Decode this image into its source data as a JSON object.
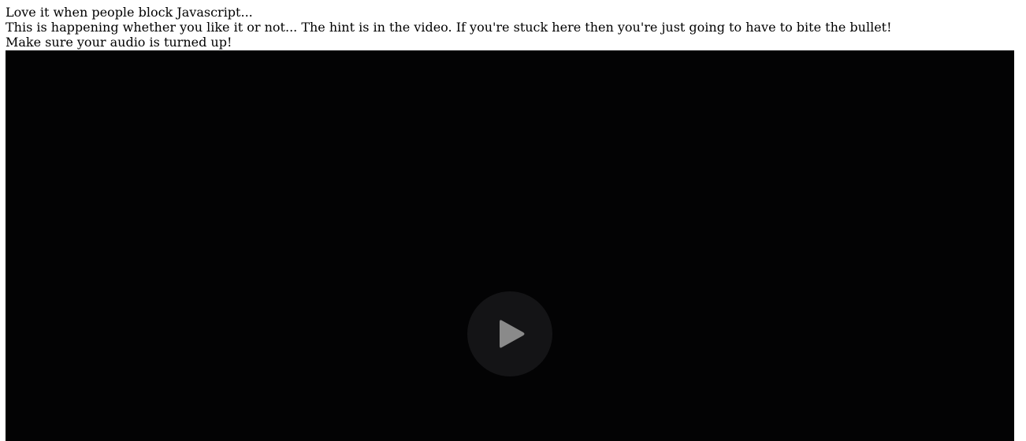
{
  "messages": {
    "line1": "Love it when people block Javascript...",
    "line2": "This is happening whether you like it or not... The hint is in the video. If you're stuck here then you're just going to have to bite the bullet!",
    "line3": "Make sure your audio is turned up!"
  },
  "video": {
    "play_icon": "play-icon",
    "background_color": "#030304",
    "button_color": "#141416",
    "icon_color": "#8a8a8a"
  }
}
